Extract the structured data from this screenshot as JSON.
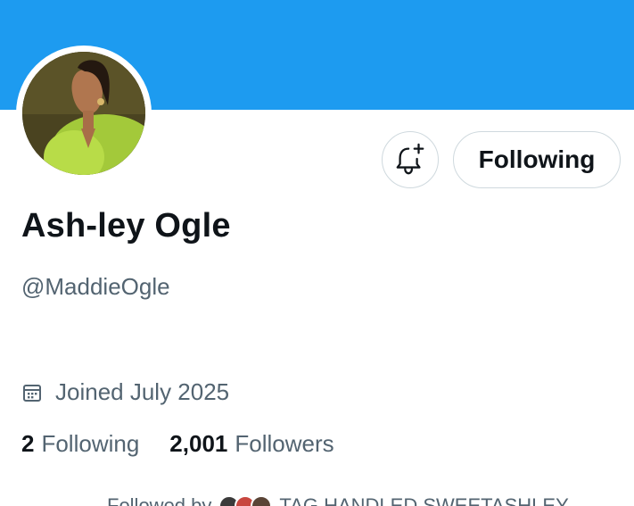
{
  "profile": {
    "display_name": "Ash-ley Ogle",
    "handle": "@MaddieOgle",
    "joined": "Joined July 2025",
    "following_count": "2",
    "following_label": "Following",
    "followers_count": "2,001",
    "followers_label": "Followers",
    "followed_by_prefix": "Followed by",
    "followed_by_names": "TAG HANDLED SWEETASHLEY"
  },
  "actions": {
    "follow_label": "Following",
    "bell_icon": "bell-plus-icon"
  },
  "icons": {
    "joined_icon": "calendar-icon"
  },
  "colors": {
    "banner": "#1d9bf0",
    "text_primary": "#0f1419",
    "text_secondary": "#536471",
    "border": "#cfd9de"
  }
}
